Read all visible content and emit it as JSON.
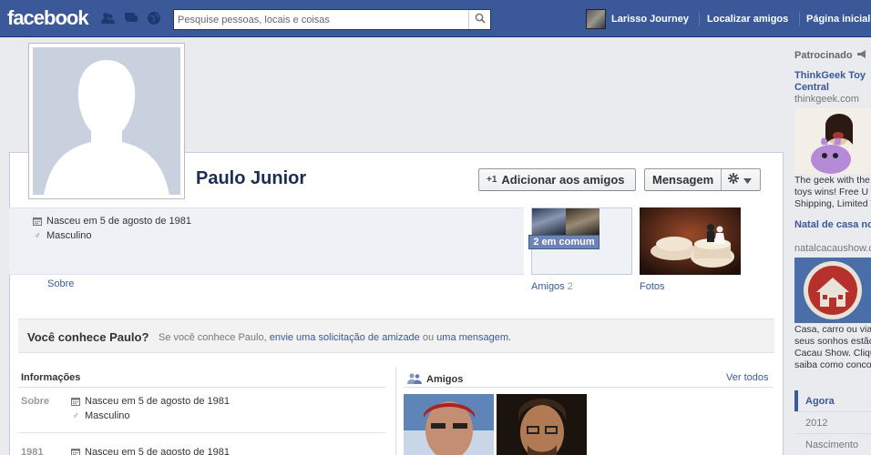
{
  "topbar": {
    "logo": "facebook",
    "search_placeholder": "Pesquise pessoas, locais e coisas",
    "user_name": "Larisso Journey",
    "nav_find_friends": "Localizar amigos",
    "nav_home": "Página inicial"
  },
  "profile": {
    "name": "Paulo Junior",
    "add_friend_label": "Adicionar aos amigos",
    "message_label": "Mensagem",
    "born": "Nasceu em 5 de agosto de 1981",
    "gender": "Masculino",
    "sobre_tab": "Sobre",
    "mutual_badge": "2 em comum",
    "friends_tab": "Amigos",
    "friends_count": "2",
    "photos_tab": "Fotos"
  },
  "know_box": {
    "title": "Você conhece Paulo?",
    "prefix": "Se você conhece Paulo,",
    "link_request": "envie uma solicitação de amizade",
    "or": "ou",
    "link_message": "uma mensagem."
  },
  "informacoes": {
    "heading": "Informações",
    "rows": [
      {
        "label": "Sobre",
        "lines": [
          "Nasceu em 5 de agosto de 1981",
          "Masculino"
        ]
      },
      {
        "label": "1981",
        "lines": [
          "Nasceu em 5 de agosto de 1981"
        ]
      }
    ]
  },
  "amigos": {
    "heading": "Amigos",
    "see_all": "Ver todos"
  },
  "sidebar": {
    "sponsored": "Patrocinado",
    "ads": [
      {
        "title": "ThinkGeek Toy Central",
        "domain": "thinkgeek.com",
        "text": [
          "The geek with the",
          "toys wins! Free U",
          "Shipping, Limited T"
        ]
      },
      {
        "title": "Natal de casa nova?",
        "domain": "natalcacaushow.co",
        "text": [
          "Casa, carro ou via",
          "seus sonhos estão",
          "Cacau Show. Cliqu",
          "saiba como conco"
        ]
      }
    ],
    "timeline": [
      "Agora",
      "2012",
      "Nascimento"
    ]
  },
  "colors": {
    "brand_blue": "#3b5998",
    "topbar_border": "#133783",
    "link": "#3b5998",
    "page_bg": "#e9ebee"
  },
  "icons": [
    "friend-requests-icon",
    "messages-icon",
    "notifications-globe-icon",
    "search-icon",
    "add-friend-icon",
    "gear-icon",
    "chevron-down-icon",
    "calendar-icon",
    "male-icon",
    "friends-icon",
    "megaphone-icon"
  ]
}
